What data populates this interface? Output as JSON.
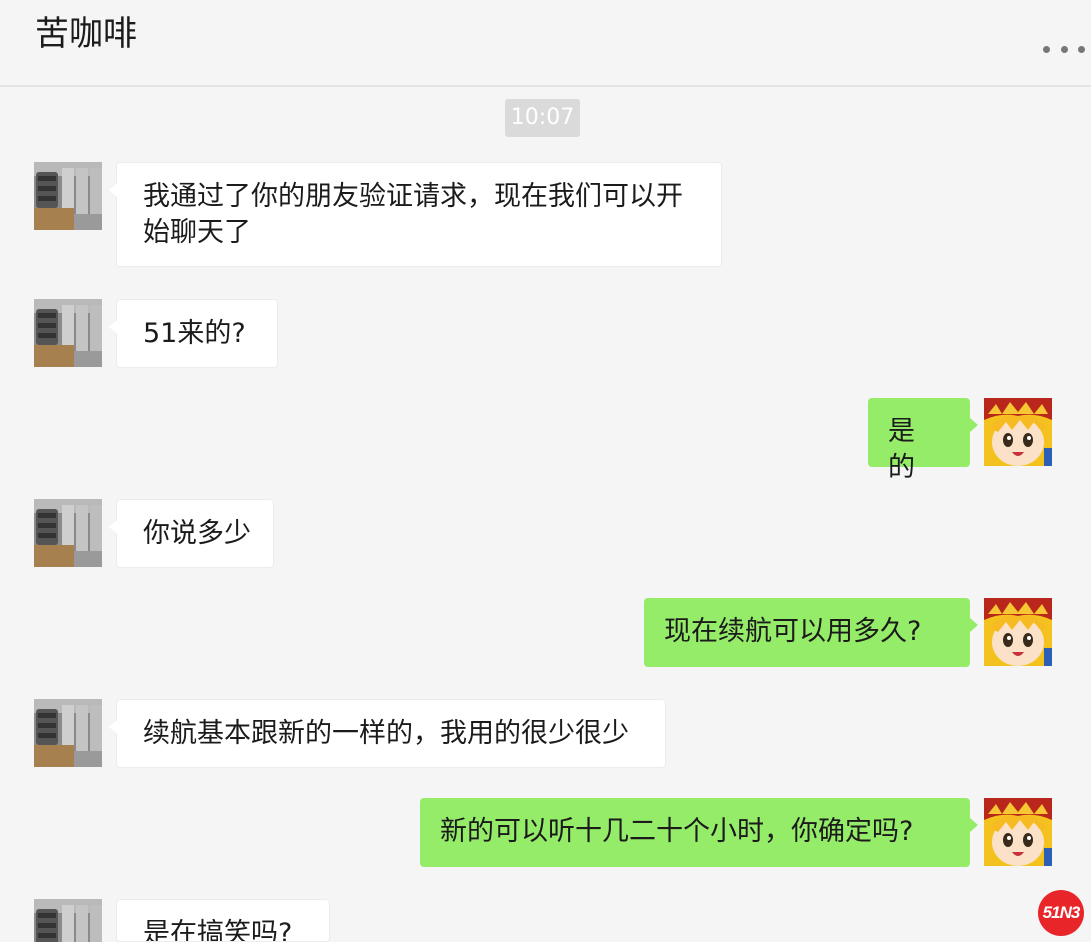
{
  "header": {
    "title": "苦咖啡",
    "more_icon": "more-dots-icon"
  },
  "timestamp": "10:07",
  "messages": [
    {
      "side": "in",
      "text": "我通过了你的朋友验证请求，现在我们可以开始聊天了",
      "avatar": "speaker-photo-avatar"
    },
    {
      "side": "in",
      "text": "51来的?",
      "avatar": "speaker-photo-avatar"
    },
    {
      "side": "out",
      "text": "是的",
      "avatar": "cartoon-boy-avatar"
    },
    {
      "side": "in",
      "text": "你说多少",
      "avatar": "speaker-photo-avatar"
    },
    {
      "side": "out",
      "text": "现在续航可以用多久?",
      "avatar": "cartoon-boy-avatar"
    },
    {
      "side": "in",
      "text": "续航基本跟新的一样的，我用的很少很少",
      "avatar": "speaker-photo-avatar"
    },
    {
      "side": "out",
      "text": "新的可以听十几二十个小时，你确定吗?",
      "avatar": "cartoon-boy-avatar"
    },
    {
      "side": "in",
      "text": "是在搞笑吗?",
      "avatar": "speaker-photo-avatar"
    }
  ],
  "watermark": {
    "text": "51N3"
  },
  "colors": {
    "background": "#f5f5f5",
    "incoming_bubble": "#ffffff",
    "outgoing_bubble": "#95ec69",
    "timestamp_bg": "#dadada",
    "watermark": "#e8262a"
  }
}
